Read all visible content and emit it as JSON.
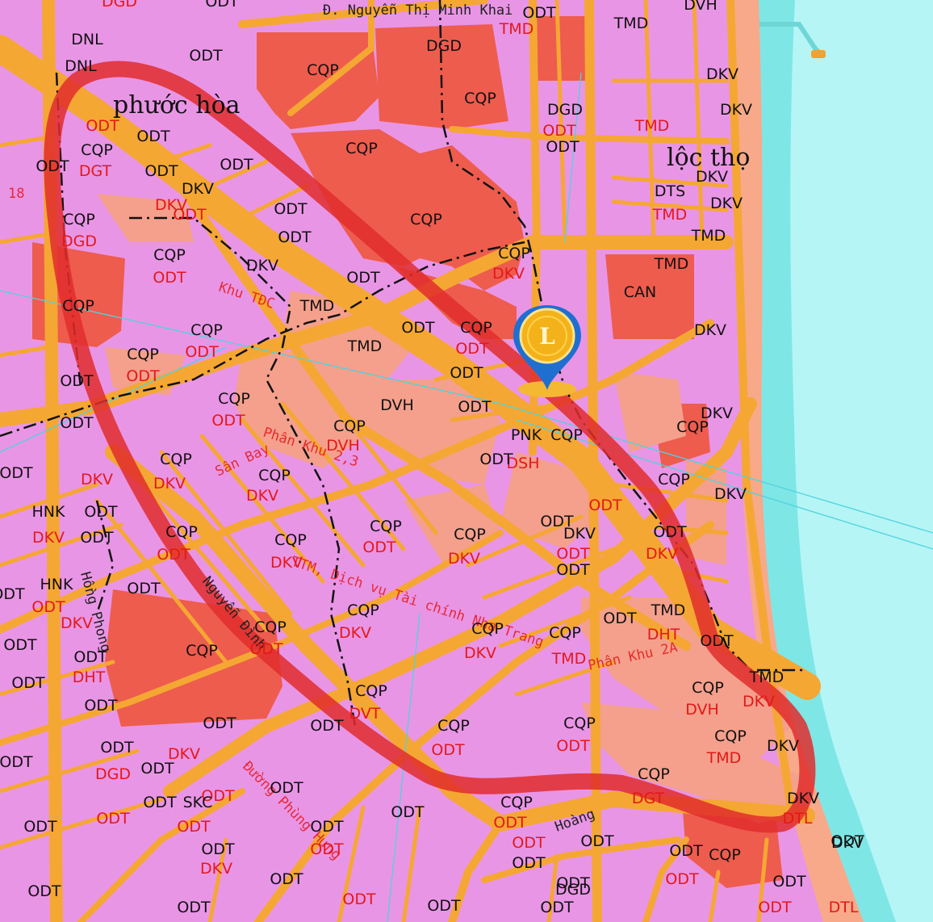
{
  "areas": {
    "phuoc_hoa": "phước hòa",
    "loc_tho": "lộc thọ"
  },
  "street_top": "Đ. Nguyễn Thị Minh Khai",
  "road_texts": {
    "khu_tdc": "Khu TĐC",
    "phan_khu_23": "Phân Khu 2,3",
    "san_bay": "Sân Bay",
    "ttm": "TTM, Dịch vụ Tài chính Nha Trang",
    "phan_khu_2a": "Phân Khu 2A",
    "nguyen_dinh_chieu": "Nguyễn Đình",
    "hoang_dieu": "Hoàng",
    "phung_hung": "Đường Phùng Hưng",
    "hong_phong": "Hồng Phong",
    "ba18": "18"
  },
  "marker": {
    "name": "location-pin"
  },
  "labels": [
    [
      "CQP",
      400,
      93,
      "b"
    ],
    [
      "DGD",
      550,
      63,
      "b"
    ],
    [
      "ODT",
      255,
      75,
      "b"
    ],
    [
      "DNL",
      108,
      55,
      "b"
    ],
    [
      "DNL",
      100,
      88,
      "b"
    ],
    [
      "ODT",
      275,
      8,
      "b"
    ],
    [
      "DGD",
      148,
      8,
      "r"
    ],
    [
      "TMD",
      640,
      42,
      "r"
    ],
    [
      "ODT",
      668,
      22,
      "b"
    ],
    [
      "TMD",
      782,
      35,
      "b"
    ],
    [
      "DVH",
      868,
      12,
      "b"
    ],
    [
      "DKV",
      895,
      98,
      "b"
    ],
    [
      "DKV",
      912,
      142,
      "b"
    ],
    [
      "CQP",
      595,
      128,
      "b"
    ],
    [
      "DGD",
      700,
      142,
      "b"
    ],
    [
      "ODT",
      693,
      168,
      "r"
    ],
    [
      "ODT",
      697,
      188,
      "b"
    ],
    [
      "TMD",
      808,
      162,
      "r"
    ],
    [
      "CQP",
      448,
      190,
      "b"
    ],
    [
      "ODT",
      190,
      175,
      "b"
    ],
    [
      "ODT",
      127,
      162,
      "r"
    ],
    [
      "CQP",
      120,
      192,
      "b"
    ],
    [
      "DGT",
      118,
      218,
      "r"
    ],
    [
      "ODT",
      65,
      212,
      "b"
    ],
    [
      "ODT",
      293,
      210,
      "b"
    ],
    [
      "ODT",
      200,
      218,
      "b"
    ],
    [
      "DKV",
      245,
      240,
      "b"
    ],
    [
      "DKV",
      212,
      260,
      "r"
    ],
    [
      "ODT",
      235,
      272,
      "r"
    ],
    [
      "CQP",
      528,
      278,
      "b"
    ],
    [
      "DTS",
      830,
      243,
      "b"
    ],
    [
      "TMD",
      830,
      272,
      "r"
    ],
    [
      "DKV",
      882,
      225,
      "b"
    ],
    [
      "DKV",
      900,
      258,
      "b"
    ],
    [
      "TMD",
      878,
      298,
      "b"
    ],
    [
      "ODT",
      360,
      265,
      "b"
    ],
    [
      "ODT",
      365,
      300,
      "b"
    ],
    [
      "CQP",
      98,
      278,
      "b"
    ],
    [
      "DGD",
      98,
      305,
      "r"
    ],
    [
      "DKV",
      325,
      335,
      "b"
    ],
    [
      "CQP",
      210,
      322,
      "b"
    ],
    [
      "ODT",
      210,
      350,
      "r"
    ],
    [
      "CQP",
      637,
      320,
      "b"
    ],
    [
      "DKV",
      630,
      345,
      "r"
    ],
    [
      "TMD",
      832,
      333,
      "b"
    ],
    [
      "CAN",
      793,
      368,
      "b"
    ],
    [
      "ODT",
      450,
      350,
      "b"
    ],
    [
      "TMD",
      393,
      385,
      "b"
    ],
    [
      "CQP",
      97,
      385,
      "b"
    ],
    [
      "DKV",
      880,
      415,
      "b"
    ],
    [
      "ODT",
      518,
      412,
      "b"
    ],
    [
      "CQP",
      590,
      412,
      "b"
    ],
    [
      "ODT",
      585,
      438,
      "r"
    ],
    [
      "TMD",
      452,
      435,
      "b"
    ],
    [
      "CQP",
      256,
      415,
      "b"
    ],
    [
      "ODT",
      250,
      442,
      "r"
    ],
    [
      "CQP",
      177,
      445,
      "b"
    ],
    [
      "ODT",
      177,
      472,
      "r"
    ],
    [
      "ODT",
      95,
      478,
      "b"
    ],
    [
      "ODT",
      578,
      468,
      "b"
    ],
    [
      "DVH",
      492,
      508,
      "b"
    ],
    [
      "ODT",
      588,
      510,
      "b"
    ],
    [
      "ODT",
      95,
      530,
      "b"
    ],
    [
      "CQP",
      290,
      500,
      "b"
    ],
    [
      "ODT",
      283,
      527,
      "r"
    ],
    [
      "CQP",
      433,
      534,
      "b"
    ],
    [
      "DVH",
      425,
      558,
      "r"
    ],
    [
      "PNK",
      652,
      545,
      "b"
    ],
    [
      "DSH",
      648,
      580,
      "r"
    ],
    [
      "CQP",
      702,
      545,
      "b"
    ],
    [
      "DKV",
      888,
      518,
      "b"
    ],
    [
      "CQP",
      858,
      535,
      "b"
    ],
    [
      "ODT",
      615,
      575,
      "b"
    ],
    [
      "CQP",
      218,
      575,
      "b"
    ],
    [
      "DKV",
      210,
      605,
      "r"
    ],
    [
      "ODT",
      20,
      592,
      "b"
    ],
    [
      "CQP",
      835,
      600,
      "b"
    ],
    [
      "DKV",
      905,
      618,
      "b"
    ],
    [
      "CQP",
      340,
      595,
      "b"
    ],
    [
      "DKV",
      325,
      620,
      "r"
    ],
    [
      "DKV",
      120,
      600,
      "r"
    ],
    [
      "ODT",
      750,
      632,
      "r"
    ],
    [
      "ODT",
      125,
      640,
      "b"
    ],
    [
      "HNK",
      60,
      640,
      "b"
    ],
    [
      "DKV",
      60,
      672,
      "r"
    ],
    [
      "CQP",
      478,
      658,
      "b"
    ],
    [
      "ODT",
      470,
      684,
      "r"
    ],
    [
      "CQP",
      582,
      668,
      "b"
    ],
    [
      "DKV",
      575,
      698,
      "r"
    ],
    [
      "ODT",
      690,
      652,
      "b"
    ],
    [
      "DKV",
      718,
      667,
      "b"
    ],
    [
      "ODT",
      710,
      692,
      "r"
    ],
    [
      "ODT",
      710,
      712,
      "b"
    ],
    [
      "ODT",
      830,
      665,
      "b"
    ],
    [
      "DKV",
      820,
      692,
      "r"
    ],
    [
      "CQP",
      225,
      665,
      "b"
    ],
    [
      "ODT",
      215,
      693,
      "r"
    ],
    [
      "CQP",
      360,
      675,
      "b"
    ],
    [
      "DKV",
      355,
      703,
      "r"
    ],
    [
      "ODT",
      120,
      672,
      "b"
    ],
    [
      "ODT",
      178,
      735,
      "b"
    ],
    [
      "HNK",
      70,
      730,
      "b"
    ],
    [
      "ODT",
      60,
      758,
      "r"
    ],
    [
      "ODT",
      10,
      742,
      "b"
    ],
    [
      "DKV",
      95,
      778,
      "r"
    ],
    [
      "CQP",
      450,
      762,
      "b"
    ],
    [
      "DKV",
      440,
      790,
      "r"
    ],
    [
      "ODT",
      768,
      772,
      "b"
    ],
    [
      "TMD",
      828,
      762,
      "b"
    ],
    [
      "DHT",
      822,
      792,
      "r"
    ],
    [
      "ODT",
      888,
      800,
      "b"
    ],
    [
      "CQP",
      604,
      785,
      "b"
    ],
    [
      "DKV",
      595,
      815,
      "r"
    ],
    [
      "CQP",
      700,
      790,
      "b"
    ],
    [
      "TMD",
      705,
      822,
      "r"
    ],
    [
      "CQP",
      335,
      783,
      "b"
    ],
    [
      "ODT",
      330,
      810,
      "r"
    ],
    [
      "CQP",
      250,
      812,
      "b"
    ],
    [
      "ODT",
      25,
      805,
      "b"
    ],
    [
      "ODT",
      112,
      820,
      "b"
    ],
    [
      "DHT",
      110,
      845,
      "r"
    ],
    [
      "TMD",
      950,
      845,
      "b"
    ],
    [
      "CQP",
      877,
      858,
      "b"
    ],
    [
      "DVH",
      870,
      885,
      "r"
    ],
    [
      "DKV",
      940,
      875,
      "r"
    ],
    [
      "CQP",
      460,
      862,
      "b"
    ],
    [
      "DVT",
      452,
      890,
      "r"
    ],
    [
      "ODT",
      35,
      852,
      "b"
    ],
    [
      "ODT",
      125,
      880,
      "b"
    ],
    [
      "ODT",
      272,
      902,
      "b"
    ],
    [
      "ODT",
      405,
      905,
      "b"
    ],
    [
      "CQP",
      562,
      905,
      "b"
    ],
    [
      "ODT",
      555,
      935,
      "r"
    ],
    [
      "CQP",
      718,
      902,
      "b"
    ],
    [
      "ODT",
      710,
      930,
      "r"
    ],
    [
      "CQP",
      905,
      918,
      "b"
    ],
    [
      "TMD",
      897,
      945,
      "r"
    ],
    [
      "DKV",
      970,
      930,
      "b"
    ],
    [
      "ODT",
      145,
      932,
      "b"
    ],
    [
      "DKV",
      228,
      940,
      "r"
    ],
    [
      "DGD",
      140,
      965,
      "r"
    ],
    [
      "ODT",
      195,
      958,
      "b"
    ],
    [
      "ODT",
      20,
      950,
      "b"
    ],
    [
      "ODT",
      355,
      982,
      "b"
    ],
    [
      "ODT",
      270,
      992,
      "r"
    ],
    [
      "CQP",
      810,
      965,
      "b"
    ],
    [
      "DGT",
      803,
      995,
      "r"
    ],
    [
      "DKV",
      995,
      995,
      "b"
    ],
    [
      "DTL",
      988,
      1020,
      "r"
    ],
    [
      "CQP",
      640,
      1000,
      "b"
    ],
    [
      "ODT",
      632,
      1025,
      "r"
    ],
    [
      "SKC",
      245,
      1000,
      "b"
    ],
    [
      "ODT",
      240,
      1030,
      "r"
    ],
    [
      "ODT",
      198,
      1000,
      "b"
    ],
    [
      "ODT",
      140,
      1020,
      "r"
    ],
    [
      "ODT",
      505,
      1012,
      "b"
    ],
    [
      "ODT",
      405,
      1030,
      "b"
    ],
    [
      "ODT",
      50,
      1030,
      "b"
    ],
    [
      "ODT",
      1050,
      1048,
      "b"
    ],
    [
      "DKV",
      1050,
      1050,
      "b"
    ],
    [
      "CQP",
      898,
      1065,
      "b"
    ],
    [
      "ODT",
      740,
      1048,
      "b"
    ],
    [
      "ODT",
      655,
      1050,
      "r"
    ],
    [
      "ODT",
      850,
      1060,
      "b"
    ],
    [
      "ODT",
      845,
      1095,
      "r"
    ],
    [
      "ODT",
      270,
      1058,
      "b"
    ],
    [
      "DKV",
      268,
      1082,
      "r"
    ],
    [
      "ODT",
      405,
      1058,
      "r"
    ],
    [
      "ODT",
      655,
      1075,
      "b"
    ],
    [
      "ODT",
      355,
      1095,
      "b"
    ],
    [
      "ODT",
      710,
      1100,
      "b"
    ],
    [
      "DGD",
      710,
      1108,
      "b"
    ],
    [
      "ODT",
      978,
      1098,
      "b"
    ],
    [
      "ODT",
      445,
      1120,
      "r"
    ],
    [
      "ODT",
      55,
      1110,
      "b"
    ],
    [
      "ODT",
      550,
      1128,
      "b"
    ],
    [
      "DTL",
      1045,
      1130,
      "r"
    ],
    [
      "ODT",
      960,
      1130,
      "r"
    ],
    [
      "ODT",
      690,
      1130,
      "b"
    ],
    [
      "ODT",
      240,
      1130,
      "b"
    ]
  ]
}
